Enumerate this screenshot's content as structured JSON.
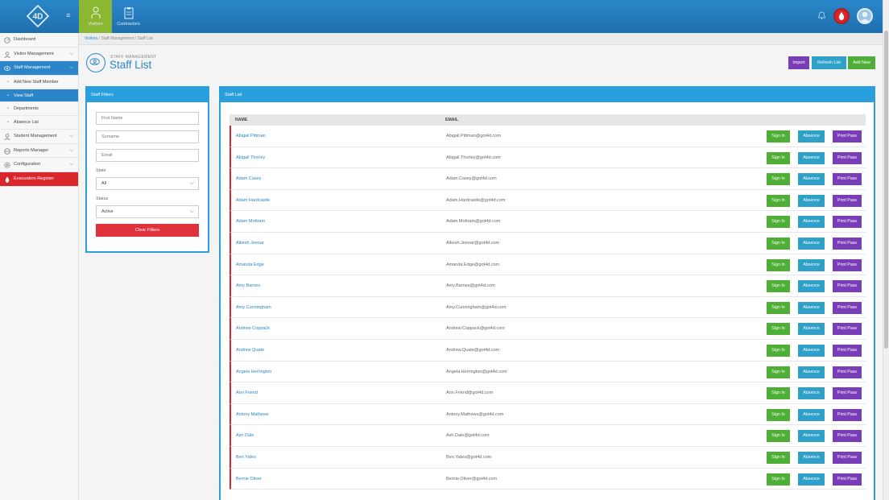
{
  "topbar": {
    "nav": [
      {
        "label": "Visitors",
        "icon": "visitor-icon"
      },
      {
        "label": "Contractors",
        "icon": "clipboard-icon"
      }
    ]
  },
  "sidebar": {
    "items": [
      {
        "label": "Dashboard"
      },
      {
        "label": "Visitor Management"
      },
      {
        "label": "Staff Management"
      },
      {
        "label": "Add New Staff Member"
      },
      {
        "label": "View Staff"
      },
      {
        "label": "Departments"
      },
      {
        "label": "Absence List"
      },
      {
        "label": "Student Management"
      },
      {
        "label": "Reports Manager"
      },
      {
        "label": "Configuration"
      },
      {
        "label": "Evacuation Register"
      }
    ]
  },
  "breadcrumb": {
    "root": "Visitors",
    "sep1": "/",
    "mid": "Staff Management",
    "sep2": "/",
    "current": "Staff List"
  },
  "page": {
    "subtitle": "STAFF MANAGEMENT",
    "title": "Staff List",
    "import_label": "Import",
    "refresh_label": "Refresh List",
    "add_label": "Add New"
  },
  "filters": {
    "heading": "Staff Filters",
    "first_name_placeholder": "First Name",
    "surname_placeholder": "Surname",
    "email_placeholder": "Email",
    "state_label": "State",
    "state_value": "All",
    "status_label": "Status",
    "status_value": "Active",
    "clear_label": "Clear Filters"
  },
  "list": {
    "heading": "Staff List",
    "col_name": "NAME",
    "col_email": "EMAIL",
    "signin_label": "Sign In",
    "absence_label": "Absence",
    "print_label": "Print Pass",
    "rows": [
      {
        "name": "Abigail Pittman",
        "email": "Abigail.Pittman@got4d.com"
      },
      {
        "name": "Abigail Thorley",
        "email": "Abigail.Thorley@got4d.com"
      },
      {
        "name": "Adam Casey",
        "email": "Adam.Casey@got4d.com"
      },
      {
        "name": "Adam Hardcastle",
        "email": "Adam.Hardcastle@got4d.com"
      },
      {
        "name": "Adam Mottram",
        "email": "Adam.Mottram@got4d.com"
      },
      {
        "name": "Alkesh Jeenar",
        "email": "Alkesh.Jeenar@got4d.com"
      },
      {
        "name": "Amanda Edge",
        "email": "Amanda.Edge@got4d.com"
      },
      {
        "name": "Amy Barnes",
        "email": "Amy.Barnes@got4d.com"
      },
      {
        "name": "Amy Cunningham",
        "email": "Amy.Cunningham@got4d.com"
      },
      {
        "name": "Andrew Coppack",
        "email": "Andrew.Coppack@got4d.com"
      },
      {
        "name": "Andrew Quate",
        "email": "Andrew.Quate@got4d.com"
      },
      {
        "name": "Angela Herrington",
        "email": "Angela.Herrington@got4d.com"
      },
      {
        "name": "Ann Friend",
        "email": "Ann.Friend@got4d.com"
      },
      {
        "name": "Antony Mathews",
        "email": "Antony.Mathews@got4d.com"
      },
      {
        "name": "Ash Dale",
        "email": "Ash.Dale@got4d.com"
      },
      {
        "name": "Ben Yates",
        "email": "Ben.Yates@got4d.com"
      },
      {
        "name": "Bernie Oliver",
        "email": "Bernie.Oliver@got4d.com"
      }
    ]
  },
  "colors": {
    "primary": "#2a86c8",
    "panel": "#2a9fde",
    "active_nav": "#8ab833",
    "danger": "#d9262b",
    "success": "#4fae35",
    "info": "#2fa1c8",
    "purple": "#7a3db8"
  }
}
